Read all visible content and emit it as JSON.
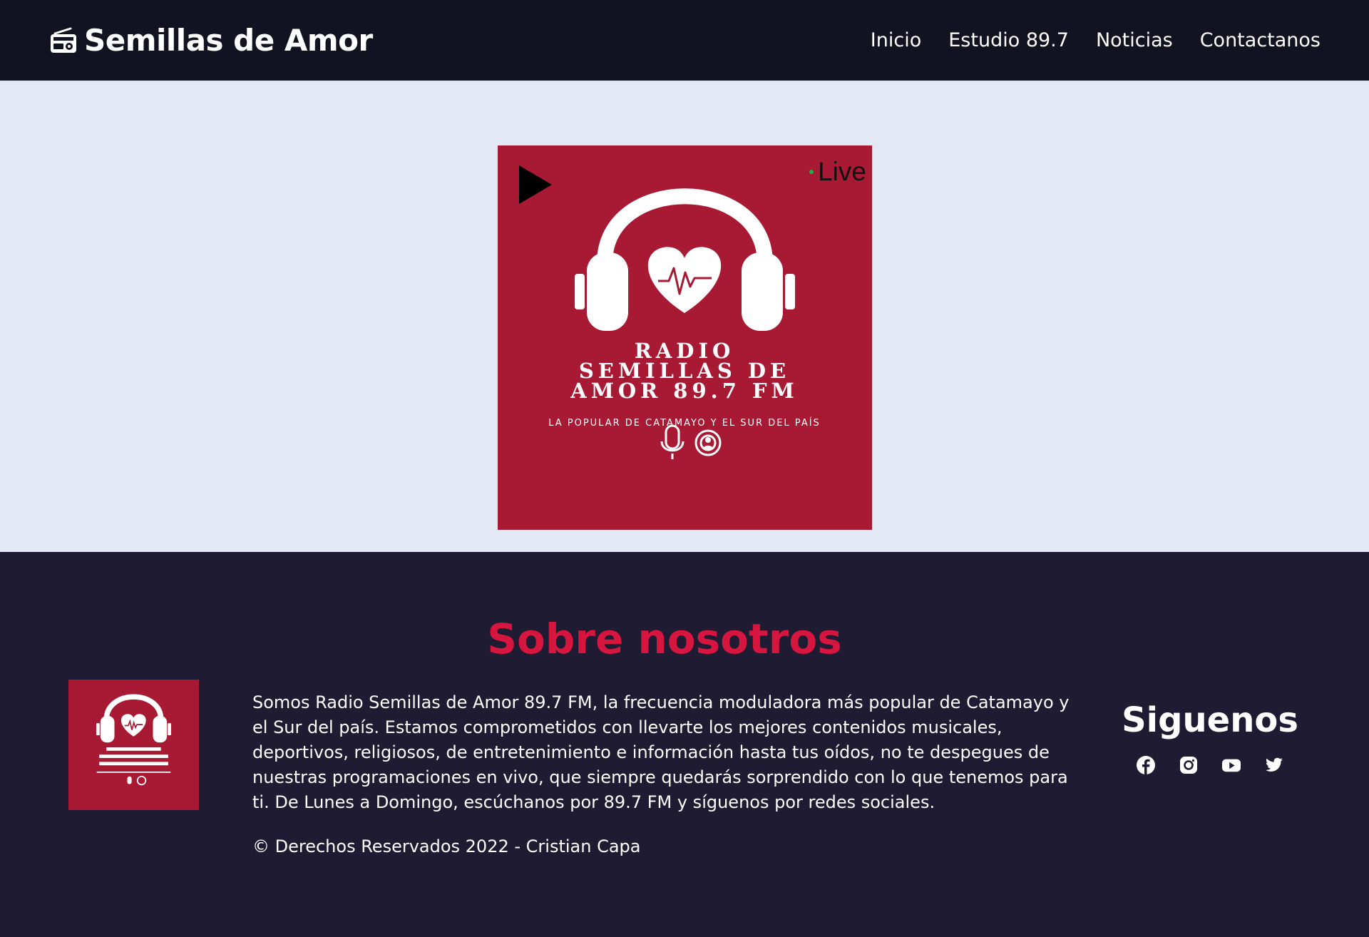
{
  "header": {
    "brand_icon": "radio-icon",
    "brand_title": "Semillas de Amor",
    "nav": [
      {
        "label": "Inicio"
      },
      {
        "label": "Estudio 89.7"
      },
      {
        "label": "Noticias"
      },
      {
        "label": "Contactanos"
      }
    ]
  },
  "player": {
    "play_icon": "play-icon",
    "live_label": "Live",
    "logo": {
      "line1": "RADIO",
      "line2": "SEMILLAS DE",
      "line3": "AMOR 89.7 FM",
      "tagline": "LA POPULAR DE CATAMAYO Y EL SUR DEL PAÍS"
    }
  },
  "footer": {
    "about_title": "Sobre nosotros",
    "about_text": "Somos Radio Semillas de Amor 89.7 FM, la frecuencia moduladora más popular de Catamayo y el Sur del país. Estamos comprometidos con llevarte los mejores contenidos musicales, deportivos, religiosos, de entretenimiento e información hasta tus oídos, no te despegues de nuestras programaciones en vivo, que siempre quedarás sorprendido con lo que tenemos para ti. De Lunes a Domingo, escúchanos por 89.7 FM y síguenos por redes sociales.",
    "copyright": "© Derechos Reservados 2022 - Cristian Capa",
    "follow_title": "Siguenos",
    "socials": [
      "facebook-icon",
      "instagram-icon",
      "youtube-icon",
      "twitter-icon"
    ]
  },
  "colors": {
    "navbar": "#121220",
    "hero_bg": "#e3e8f5",
    "brand_red": "#a81a33",
    "title_red": "#d6163f",
    "footer_bg": "#1e1b32"
  }
}
